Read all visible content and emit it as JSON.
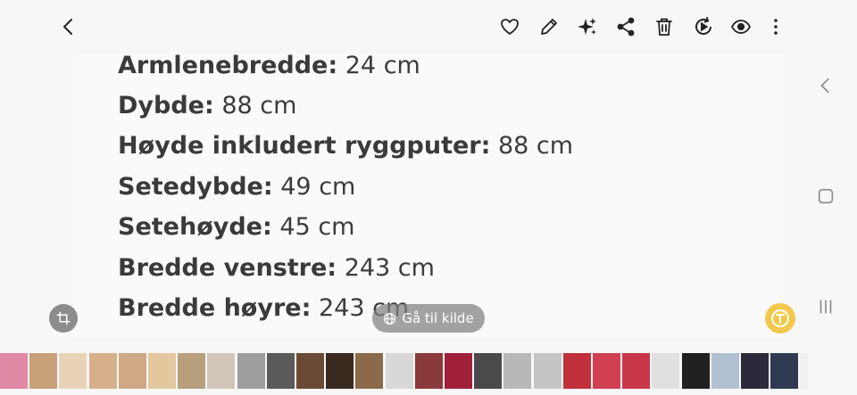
{
  "toolbar": {
    "actions": [
      {
        "name": "back-button",
        "icon": "chevron-left-icon"
      },
      {
        "name": "favorite-button",
        "icon": "heart-icon"
      },
      {
        "name": "edit-button",
        "icon": "pencil-icon"
      },
      {
        "name": "ai-edit-button",
        "icon": "sparkle-icon"
      },
      {
        "name": "share-button",
        "icon": "share-icon"
      },
      {
        "name": "delete-button",
        "icon": "trash-icon"
      },
      {
        "name": "remaster-button",
        "icon": "play-circle-icon"
      },
      {
        "name": "view-button",
        "icon": "eye-icon"
      },
      {
        "name": "more-button",
        "icon": "more-vertical-icon"
      }
    ]
  },
  "image_content": {
    "lines": [
      {
        "label": "Armlenebredde:",
        "value": " 24 cm"
      },
      {
        "label": "Dybde:",
        "value": " 88 cm"
      },
      {
        "label": "Høyde inkludert ryggputer:",
        "value": " 88 cm"
      },
      {
        "label": "Setedybde:",
        "value": " 49 cm"
      },
      {
        "label": "Setehøyde:",
        "value": " 45 cm"
      },
      {
        "label": "Bredde venstre:",
        "value": " 243 cm"
      },
      {
        "label": "Bredde høyre:",
        "value": " 243 cm"
      }
    ]
  },
  "overlay": {
    "source_label": "Gå til kilde",
    "crop_icon": "crop-icon",
    "text_extract_icon": "text-extract-icon"
  },
  "system_nav": {
    "icons": [
      "back-icon",
      "home-icon",
      "recents-icon"
    ]
  },
  "filmstrip": {
    "thumb_count": 29,
    "colors": [
      "#e08aa6",
      "#c8a07a",
      "#e9d3b8",
      "#d6b08a",
      "#cfa985",
      "#e3c79f",
      "#b9a07c",
      "#d2c6b9",
      "#9e9e9e",
      "#5a5a5a",
      "#6b4a35",
      "#3a2a20",
      "#8a6a4a",
      "#d8d8d8",
      "#8a3a3a",
      "#a0203a",
      "#4a4a4a",
      "#b8b8b8",
      "#c5c5c5",
      "#c0303a",
      "#d04050",
      "#c83848",
      "#e0e0e0",
      "#202020",
      "#b0c0d0",
      "#2a2a3a",
      "#303a50",
      "#f0f0f0",
      "#e8e8e8"
    ]
  }
}
